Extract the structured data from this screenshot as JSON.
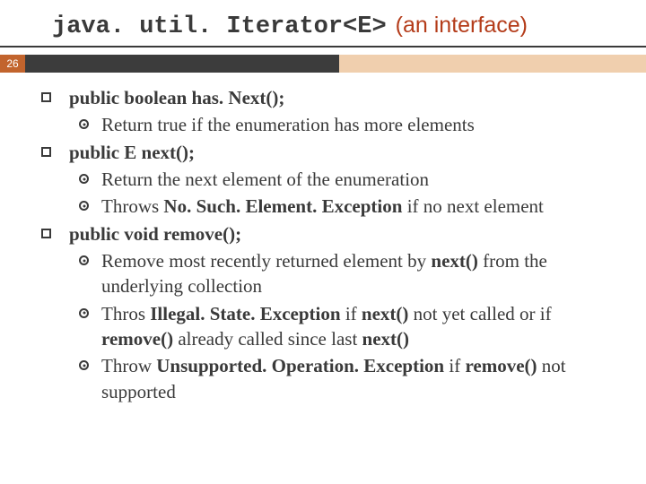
{
  "slide_number": "26",
  "title_code": "java. util. Iterator<E>",
  "title_suffix": "(an interface)",
  "bullets": [
    {
      "sig_pre": "public boolean",
      "sig_name": " has. Next();",
      "subs": [
        {
          "plain": "Return true if the enumeration has more elements"
        }
      ]
    },
    {
      "sig_pre": "public E next();",
      "sig_name": "",
      "subs": [
        {
          "plain": "Return the next element of the enumeration"
        },
        {
          "pre": "Throws ",
          "bold": "No. Such. Element. Exception",
          "post": " if no next element"
        }
      ]
    },
    {
      "sig_pre": "public void remove();",
      "sig_name": "",
      "subs": [
        {
          "pre": "Remove most recently returned element by ",
          "bold": "next()",
          "post": " from the underlying collection"
        },
        {
          "pre": "Thros ",
          "bold": "Illegal. State. Exception",
          "post_pre": " if ",
          "bold2": "next()",
          "post_mid": " not yet called or if ",
          "bold3": "remove()",
          "post_mid2": " already called since last ",
          "bold4": "next()"
        },
        {
          "pre": "Throw ",
          "bold": "Unsupported. Operation. Exception",
          "post_pre": " if ",
          "bold2": "remove()",
          "post": " not supported"
        }
      ]
    }
  ]
}
